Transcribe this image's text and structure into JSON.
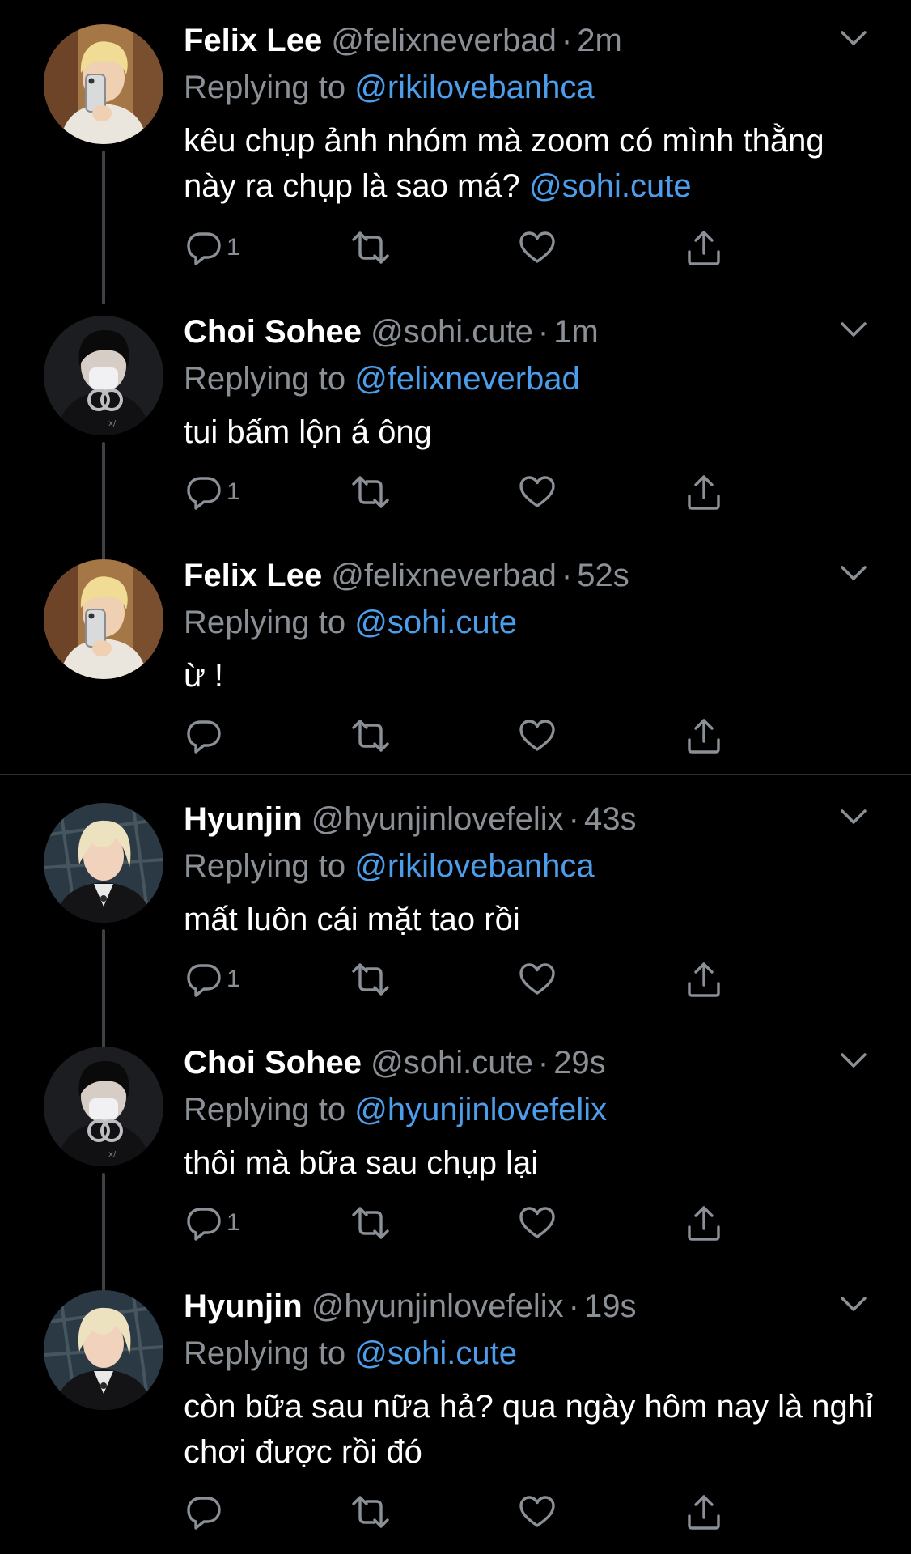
{
  "reply_prefix": "Replying to",
  "separator": "·",
  "tweets": [
    {
      "name": "Felix Lee",
      "handle": "@felixneverbad",
      "time": "2m",
      "replying_to": "@rikilovebanhca",
      "text": "kêu chụp ảnh nhóm mà zoom có mình thằng này ra chụp là sao má?",
      "text_mention": "@sohi.cute",
      "reply_count": "1",
      "avatar": "felix-avatar"
    },
    {
      "name": "Choi Sohee",
      "handle": "@sohi.cute",
      "time": "1m",
      "replying_to": "@felixneverbad",
      "text": "tui bấm lộn á ông",
      "reply_count": "1",
      "avatar": "sohee-avatar"
    },
    {
      "name": "Felix Lee",
      "handle": "@felixneverbad",
      "time": "52s",
      "replying_to": "@sohi.cute",
      "text": "ừ !",
      "reply_count": "",
      "avatar": "felix-avatar"
    },
    {
      "name": "Hyunjin",
      "handle": "@hyunjinlovefelix",
      "time": "43s",
      "replying_to": "@rikilovebanhca",
      "text": "mất luôn cái mặt tao rồi",
      "reply_count": "1",
      "avatar": "hyunjin-avatar"
    },
    {
      "name": "Choi Sohee",
      "handle": "@sohi.cute",
      "time": "29s",
      "replying_to": "@hyunjinlovefelix",
      "text": "thôi mà bữa sau chụp lại",
      "reply_count": "1",
      "avatar": "sohee-avatar"
    },
    {
      "name": "Hyunjin",
      "handle": "@hyunjinlovefelix",
      "time": "19s",
      "replying_to": "@sohi.cute",
      "text": "còn bữa sau nữa hả? qua ngày hôm nay là nghỉ chơi được rồi đó",
      "reply_count": "",
      "avatar": "hyunjin-avatar"
    }
  ],
  "colors": {
    "background": "#000000",
    "name": "#ffffff",
    "muted": "#8b9097",
    "mention": "#4c9eeb",
    "thread_line": "#3d4146"
  },
  "icons": [
    "chevron-down-icon",
    "reply-icon",
    "retweet-icon",
    "like-icon",
    "share-icon"
  ]
}
